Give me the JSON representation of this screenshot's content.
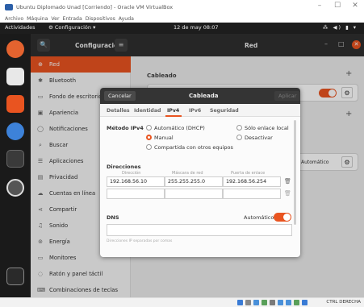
{
  "vbox": {
    "title": "Ubuntu Diplomado Unad [Corriendo] - Oracle VM VirtualBox",
    "menu": "Archivo  Máquina  Ver  Entrada  Dispositivos  Ayuda",
    "min": "–",
    "max": "☐",
    "close": "✕",
    "host_key": "CTRL DERECHA"
  },
  "topbar": {
    "activities": "Actividades",
    "app_menu": "⚙ Configuración ▾",
    "clock": "12 de may  08:07",
    "tray": "⁂ ◀) ▮ ▾"
  },
  "header": {
    "search_icon": "🔍",
    "settings_title": "Configuración",
    "menu_icon": "≡",
    "panel_title": "Red",
    "min": "–",
    "max": "□",
    "close": "✕"
  },
  "sidebar": {
    "items": [
      {
        "icon": "⊕",
        "label": "Red"
      },
      {
        "icon": "✱",
        "label": "Bluetooth"
      },
      {
        "icon": "▭",
        "label": "Fondo de escritorio"
      },
      {
        "icon": "▣",
        "label": "Apariencia"
      },
      {
        "icon": "◯",
        "label": "Notificaciones"
      },
      {
        "icon": "⌕",
        "label": "Buscar"
      },
      {
        "icon": "☰",
        "label": "Aplicaciones"
      },
      {
        "icon": "▤",
        "label": "Privacidad"
      },
      {
        "icon": "☁",
        "label": "Cuentas en línea"
      },
      {
        "icon": "⋖",
        "label": "Compartir"
      },
      {
        "icon": "♫",
        "label": "Sonido"
      },
      {
        "icon": "⊚",
        "label": "Energía"
      },
      {
        "icon": "▭",
        "label": "Monitores"
      },
      {
        "icon": "◌",
        "label": "Ratón y panel táctil"
      },
      {
        "icon": "⌨",
        "label": "Combinaciones de teclas"
      }
    ]
  },
  "main": {
    "section_wired": "Cableado",
    "add": "+",
    "auto_label": "Automático",
    "gear": "⚙"
  },
  "dialog": {
    "cancel": "Cancelar",
    "title": "Cableada",
    "apply": "Aplicar",
    "tabs": [
      "Detalles",
      "Identidad",
      "IPv4",
      "IPv6",
      "Seguridad"
    ],
    "method_label": "Método IPv4",
    "opt_dhcp": "Automático (DHCP)",
    "opt_link_local": "Sólo enlace local",
    "opt_manual": "Manual",
    "opt_disable": "Desactivar",
    "opt_share": "Compartida con otros equipos",
    "addresses_label": "Direcciones",
    "col_address": "Dirección",
    "col_netmask": "Máscara de red",
    "col_gateway": "Puerta de enlace",
    "address": "192.168.56.10",
    "netmask": "255.255.255.0",
    "gateway": "192.168.56.254",
    "trash_icon": "🗑",
    "dns_label": "DNS",
    "dns_auto": "Automático",
    "dns_hint": "Direcciones IP separadas por comas"
  }
}
